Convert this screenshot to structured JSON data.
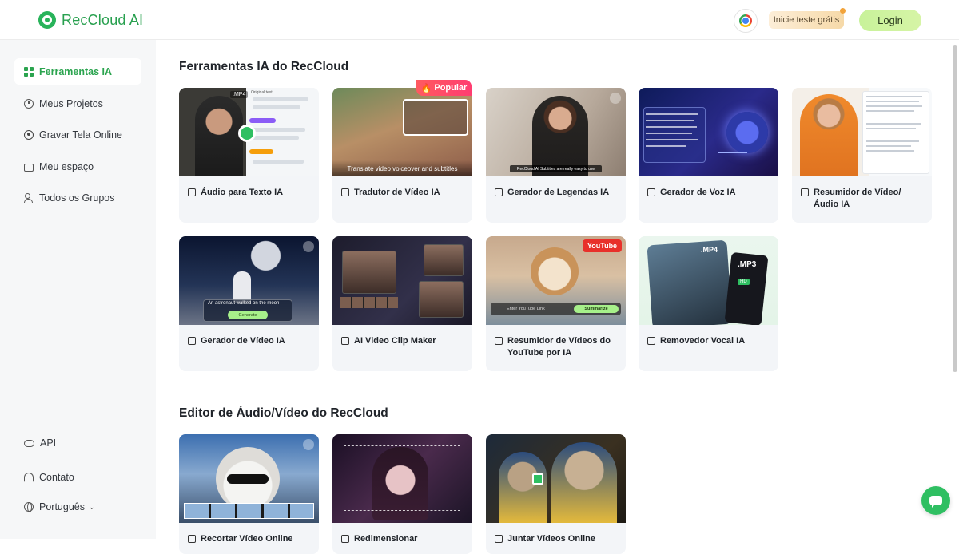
{
  "header": {
    "logo_text": "RecCloud AI",
    "trial_label": "Inicie teste grátis",
    "login_label": "Login"
  },
  "sidebar": {
    "items": [
      {
        "label": "Ferramentas IA",
        "icon": "grid-icon",
        "active": true
      },
      {
        "label": "Meus Projetos",
        "icon": "history-icon"
      },
      {
        "label": "Gravar Tela Online",
        "icon": "record-icon"
      },
      {
        "label": "Meu espaço",
        "icon": "folder-icon"
      },
      {
        "label": "Todos os Grupos",
        "icon": "users-icon"
      }
    ],
    "footer": {
      "api_label": "API",
      "contact_label": "Contato",
      "language_label": "Português"
    }
  },
  "sections": {
    "ai_tools_title": "Ferramentas IA do RecCloud",
    "editor_title": "Editor de Áudio/Vídeo do RecCloud"
  },
  "ai_tools": [
    {
      "label": "Áudio para Texto IA",
      "thumb_text": ".MP4",
      "thumb_subtext": "Original text"
    },
    {
      "label": "Tradutor de Vídeo IA",
      "badge": "Popular",
      "thumb_text": "Translate video voiceover and subtitles"
    },
    {
      "label": "Gerador de Legendas IA",
      "thumb_text": "RecCloud AI Subtitles are really easy to use"
    },
    {
      "label": "Gerador de Voz IA"
    },
    {
      "label": "Resumidor de Vídeo/Áudio IA"
    },
    {
      "label": "Gerador de Vídeo IA",
      "thumb_text": "An astronaut walked on the moon",
      "thumb_button": "Generate"
    },
    {
      "label": "AI Video Clip Maker"
    },
    {
      "label": "Resumidor de Vídeos do YouTube por IA",
      "badge": "YouTube",
      "thumb_text": "Enter YouTube Link",
      "thumb_button": "Summarize"
    },
    {
      "label": "Removedor Vocal IA",
      "thumb_text": ".MP4",
      "thumb_text_2": ".MP3",
      "thumb_badge": "HD"
    }
  ],
  "editor_tools": [
    {
      "label": "Recortar Vídeo Online"
    },
    {
      "label": "Redimensionar"
    },
    {
      "label": "Juntar Vídeos Online"
    }
  ],
  "colors": {
    "brand_green": "#2ba44f",
    "popular_badge": "#ff4a66",
    "youtube_badge": "#e8302a"
  }
}
